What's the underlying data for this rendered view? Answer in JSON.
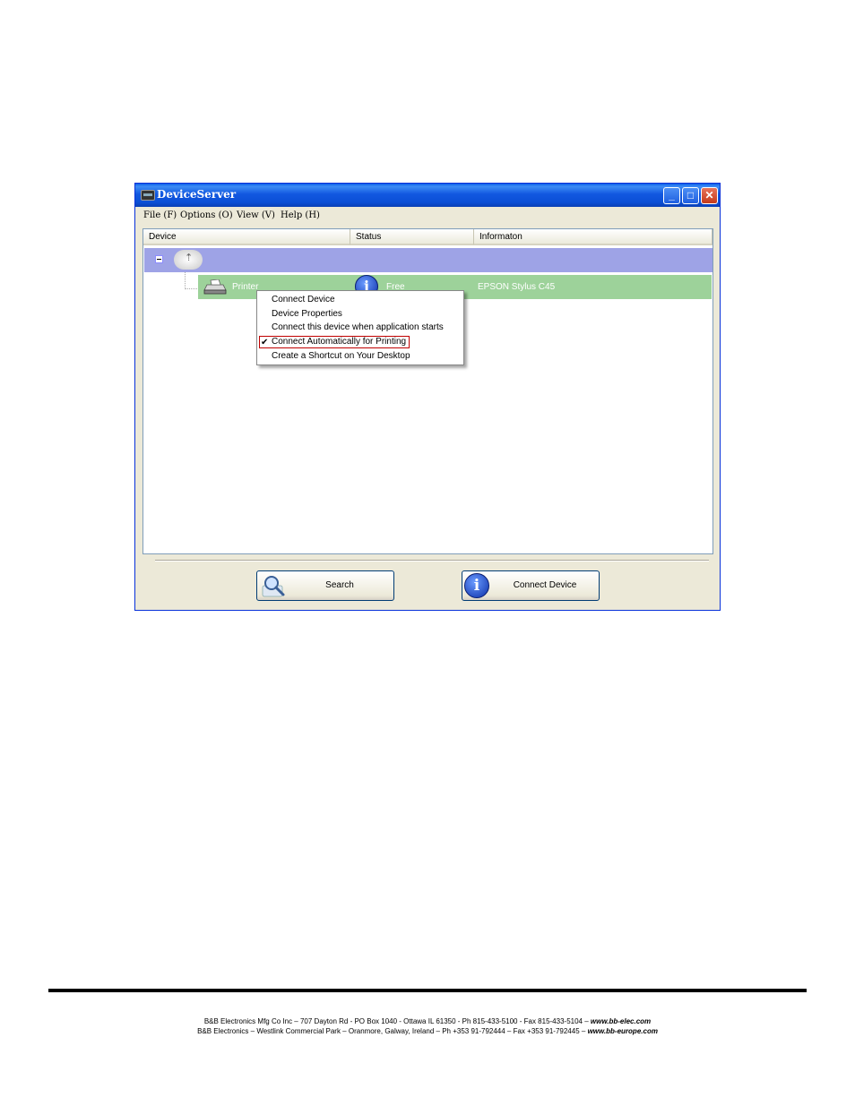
{
  "window": {
    "title": "DeviceServer",
    "controls": [
      "minimize",
      "maximize",
      "close"
    ]
  },
  "menubar": {
    "items": [
      "File (F)",
      "Options (O)",
      "View (V)",
      "Help (H)"
    ]
  },
  "list": {
    "columns": [
      "Device",
      "Status",
      "Informaton"
    ],
    "rows": [
      {
        "device": "",
        "status": "",
        "info": "",
        "icon": "cloud-usb-icon"
      },
      {
        "device": "Printer",
        "status": "Free",
        "info": "EPSON Stylus C45",
        "icon": "printer-icon"
      }
    ]
  },
  "context_menu": {
    "items": [
      "Connect Device",
      "Device Properties",
      "Connect this device when application starts",
      "Connect Automatically for Printing",
      "Create a Shortcut on Your Desktop"
    ],
    "checked_index": 3,
    "check_glyph": "✔"
  },
  "buttons": {
    "search": "Search",
    "connect": "Connect Device"
  },
  "footer": {
    "line1_text": "B&B Electronics Mfg Co Inc – 707 Dayton Rd - PO Box 1040 - Ottawa IL 61350 - Ph 815-433-5100 - Fax 815-433-5104 – ",
    "line1_url": "www.bb-elec.com",
    "line2_text": "B&B Electronics – Westlink Commercial Park – Oranmore, Galway, Ireland – Ph +353 91-792444 – Fax +353 91-792445 – ",
    "line2_url": "www.bb-europe.com"
  },
  "colors": {
    "titlebar": "#0b4fd6",
    "host_row": "#9ea3e6",
    "printer_row": "#9dd29a",
    "highlight_box": "#c00000"
  }
}
